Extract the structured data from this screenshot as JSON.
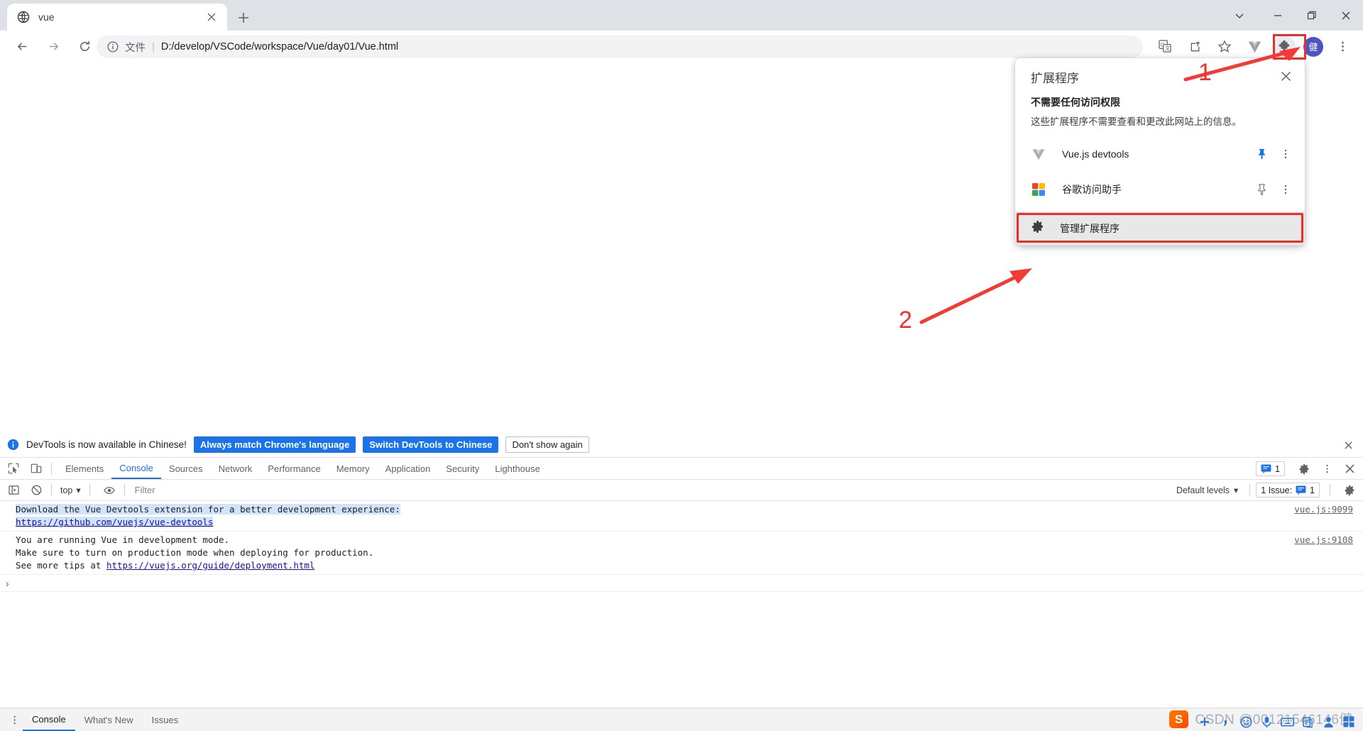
{
  "window": {
    "controls": [
      "chevron-down",
      "minimize",
      "restore",
      "close"
    ]
  },
  "tabstrip": {
    "tab_title": "vue",
    "favicon": "globe-icon",
    "close_label": "×",
    "new_tab_label": "+"
  },
  "toolbar": {
    "back": "←",
    "forward": "→",
    "reload": "↻",
    "omnibox": {
      "info_icon": "info-circle-icon",
      "scheme_label": "文件",
      "separator": "|",
      "url": "D:/develop/VSCode/workspace/Vue/day01/Vue.html"
    },
    "icons": [
      "translate-icon",
      "share-icon",
      "bookmark-star-icon",
      "vue-devtools-icon",
      "extensions-puzzle-icon"
    ],
    "avatar_label": "健",
    "menu_label": "⋮"
  },
  "extensions_popup": {
    "title": "扩展程序",
    "close_label": "×",
    "section_title": "不需要任何访问权限",
    "section_desc": "这些扩展程序不需要查看和更改此网站上的信息。",
    "items": [
      {
        "name": "Vue.js devtools",
        "icon": "vue-chevron-icon",
        "pinned": true,
        "pin_icon": "pin-filled-icon",
        "menu": "⋮"
      },
      {
        "name": "谷歌访问助手",
        "icon": "google-squares-icon",
        "pinned": false,
        "pin_icon": "pin-outline-icon",
        "menu": "⋮"
      }
    ],
    "manage": {
      "icon": "gear-icon",
      "label": "管理扩展程序"
    }
  },
  "annotations": {
    "marker_1": "1",
    "marker_2": "2",
    "highlight_color": "#e8302b",
    "arrow_color": "#f43a35"
  },
  "devtools": {
    "banner": {
      "icon": "info-circle-icon",
      "text": "DevTools is now available in Chinese!",
      "buttons": [
        {
          "label": "Always match Chrome's language",
          "style": "primary"
        },
        {
          "label": "Switch DevTools to Chinese",
          "style": "primary"
        },
        {
          "label": "Don't show again",
          "style": "plain"
        }
      ],
      "close_label": "×"
    },
    "tools": [
      "inspect-element-icon",
      "device-toolbar-icon"
    ],
    "tabs": [
      {
        "label": "Elements",
        "active": false
      },
      {
        "label": "Console",
        "active": true
      },
      {
        "label": "Sources",
        "active": false
      },
      {
        "label": "Network",
        "active": false
      },
      {
        "label": "Performance",
        "active": false
      },
      {
        "label": "Memory",
        "active": false
      },
      {
        "label": "Application",
        "active": false
      },
      {
        "label": "Security",
        "active": false
      },
      {
        "label": "Lighthouse",
        "active": false
      }
    ],
    "right_controls": {
      "issue_chip": {
        "prefix": "1 Issue:",
        "icon": "message-icon",
        "count": "1"
      },
      "settings_icon": "gear-icon",
      "menu_icon": "kebab-icon",
      "close_icon": "close-icon"
    },
    "filterbar": {
      "execute_icon": "sidebar-toggle-icon",
      "clear_icon": "clear-console-icon",
      "context": "top",
      "context_caret": "▾",
      "eye_icon": "live-expression-icon",
      "filter_placeholder": "Filter",
      "filter_value": "",
      "levels": "Default levels",
      "levels_caret": "▾",
      "settings_icon": "gear-icon"
    },
    "console_messages": [
      {
        "lines": [
          "Download the Vue Devtools extension for a better development experience:",
          "https://github.com/vuejs/vue-devtools"
        ],
        "link_line": 1,
        "highlighted": true,
        "source": "vue.js:9099"
      },
      {
        "lines": [
          "You are running Vue in development mode.",
          "Make sure to turn on production mode when deploying for production.",
          "See more tips at https://vuejs.org/guide/deployment.html"
        ],
        "link_text": "https://vuejs.org/guide/deployment.html",
        "highlighted": false,
        "source": "vue.js:9108"
      }
    ],
    "prompt_symbol": "›",
    "drawer": {
      "kebab": "⋮",
      "tabs": [
        {
          "label": "Console",
          "active": true
        },
        {
          "label": "What's New",
          "active": false
        },
        {
          "label": "Issues",
          "active": false
        }
      ]
    }
  },
  "overlay": {
    "watermark_text": "CSDN @00121546146健",
    "sogou_logo_label": "S",
    "ime_icons": [
      "plus-icon",
      "comma-icon",
      "smiley-icon",
      "microphone-icon",
      "keyboard-icon",
      "clipboard-icon",
      "person-icon",
      "apps-icon"
    ]
  }
}
